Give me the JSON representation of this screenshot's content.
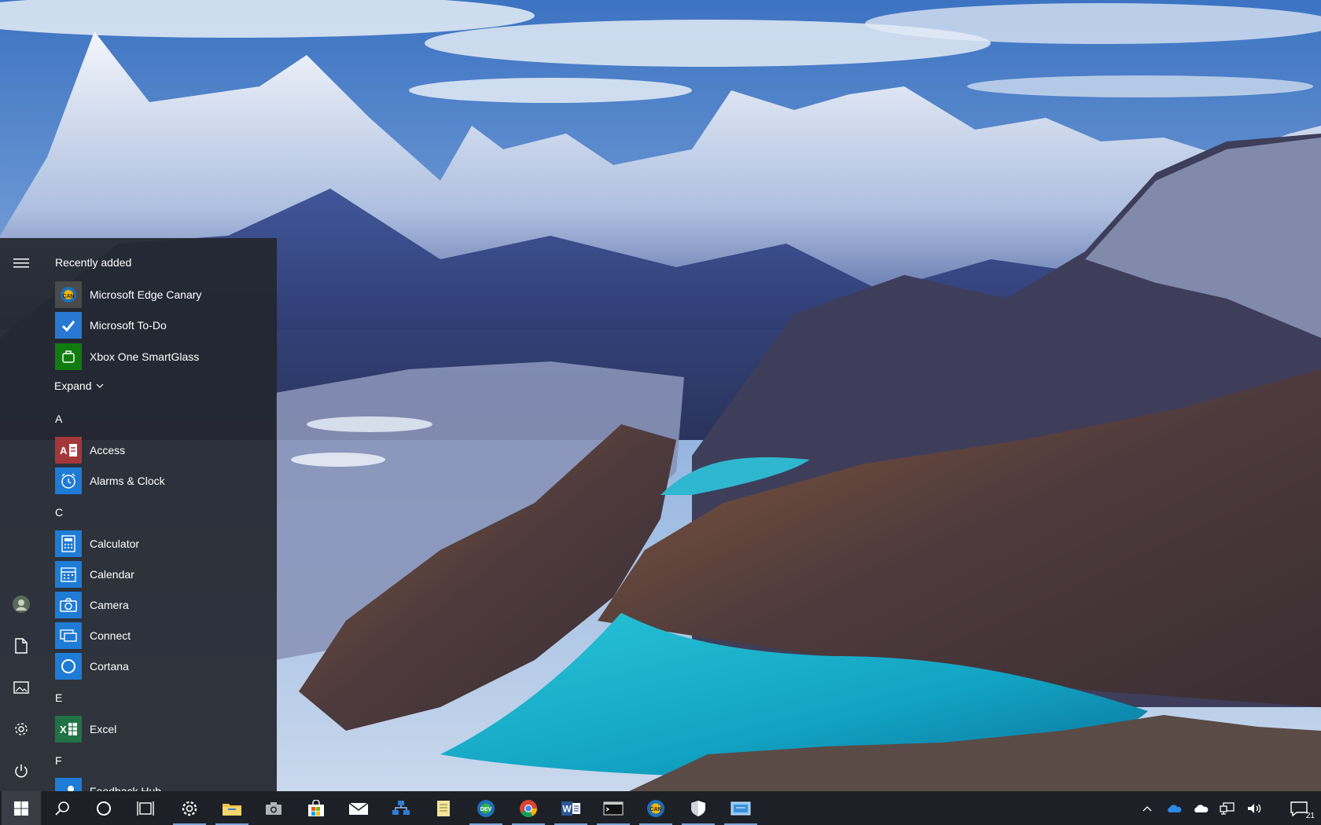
{
  "start_menu": {
    "recently_added_title": "Recently added",
    "recent_apps": [
      {
        "label": "Microsoft Edge Canary",
        "icon": "edge-canary-icon",
        "color": "#4a4a4a"
      },
      {
        "label": "Microsoft To-Do",
        "icon": "todo-icon",
        "color": "#2979d4"
      },
      {
        "label": "Xbox One SmartGlass",
        "icon": "xbox-smartglass-icon",
        "color": "#107c10"
      }
    ],
    "expand_label": "Expand",
    "groups": [
      {
        "letter": "A",
        "apps": [
          {
            "label": "Access",
            "icon": "access-icon",
            "color": "#a4373a"
          },
          {
            "label": "Alarms & Clock",
            "icon": "alarm-clock-icon",
            "color": "#1e7bd6"
          }
        ]
      },
      {
        "letter": "C",
        "apps": [
          {
            "label": "Calculator",
            "icon": "calculator-icon",
            "color": "#1e7bd6"
          },
          {
            "label": "Calendar",
            "icon": "calendar-icon",
            "color": "#1e7bd6"
          },
          {
            "label": "Camera",
            "icon": "camera-icon",
            "color": "#1e7bd6"
          },
          {
            "label": "Connect",
            "icon": "connect-icon",
            "color": "#1e7bd6"
          },
          {
            "label": "Cortana",
            "icon": "cortana-icon",
            "color": "#1e7bd6"
          }
        ]
      },
      {
        "letter": "E",
        "apps": [
          {
            "label": "Excel",
            "icon": "excel-icon",
            "color": "#217346"
          }
        ]
      },
      {
        "letter": "F",
        "apps": [
          {
            "label": "Feedback Hub",
            "icon": "feedback-hub-icon",
            "color": "#1e7bd6"
          }
        ]
      }
    ],
    "rail": [
      "hamburger-menu-icon",
      "user-avatar-icon",
      "documents-icon",
      "pictures-icon",
      "settings-icon",
      "power-icon"
    ]
  },
  "taskbar": {
    "pinned": [
      "start-icon",
      "search-icon",
      "cortana-icon",
      "task-view-icon",
      "settings-icon",
      "file-explorer-icon",
      "camera-icon",
      "store-icon",
      "mail-icon",
      "network-app-icon",
      "notepad-icon",
      "edge-dev-icon",
      "chrome-icon",
      "word-icon",
      "terminal-icon",
      "edge-canary-icon",
      "defender-icon",
      "remote-desktop-icon"
    ],
    "tray": [
      "chevron-up-icon",
      "onedrive-icon",
      "onedrive-personal-icon",
      "network-icon",
      "volume-icon"
    ],
    "notification_count": "21",
    "accent_color": "#7aa6d9"
  }
}
